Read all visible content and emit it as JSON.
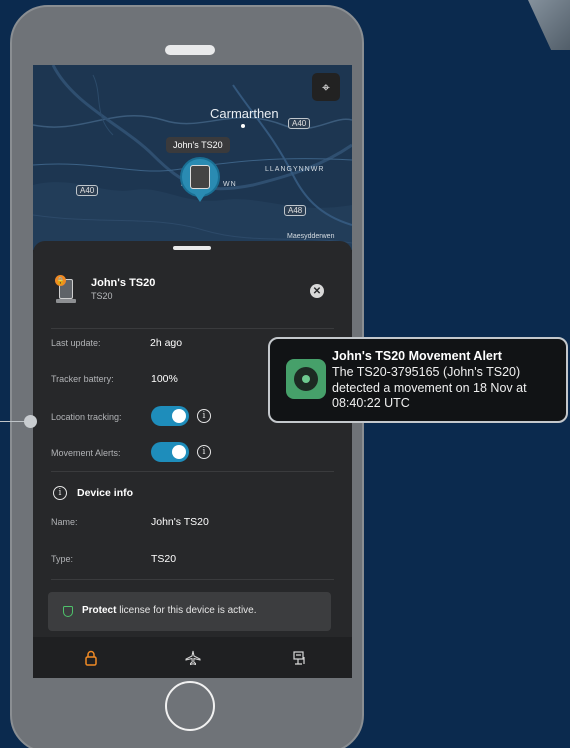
{
  "map": {
    "city": "Carmarthen",
    "road_tags": [
      "A40",
      "A40",
      "A48"
    ],
    "places": [
      "JO",
      "WN",
      "LLANGYNNWR"
    ],
    "place_small": "Maesydderwen",
    "bubble_label": "John's TS20"
  },
  "device": {
    "name": "John's TS20",
    "type": "TS20"
  },
  "details": {
    "last_update_label": "Last update:",
    "last_update_value": "2h ago",
    "battery_label": "Tracker battery:",
    "battery_value": "100%",
    "location_label": "Location tracking:",
    "location_on": true,
    "alerts_label": "Movement Alerts:",
    "alerts_on": true
  },
  "device_info": {
    "title": "Device info",
    "name_label": "Name:",
    "name_value": "John's TS20",
    "type_label": "Type:",
    "type_value": "TS20"
  },
  "license": {
    "bold": "Protect",
    "text": " license for this device is active."
  },
  "tabs": [
    "lock-icon",
    "plane-icon",
    "device-list-icon"
  ],
  "alert": {
    "title": "John's TS20 Movement Alert",
    "body": "The TS20-3795165 (John's TS20) detected a movement on 18 Nov at 08:40:22 UTC"
  },
  "colors": {
    "background": "#0b2a4e",
    "accent": "#1e8dbb",
    "orange": "#f08a24",
    "green": "#4ec26a"
  }
}
